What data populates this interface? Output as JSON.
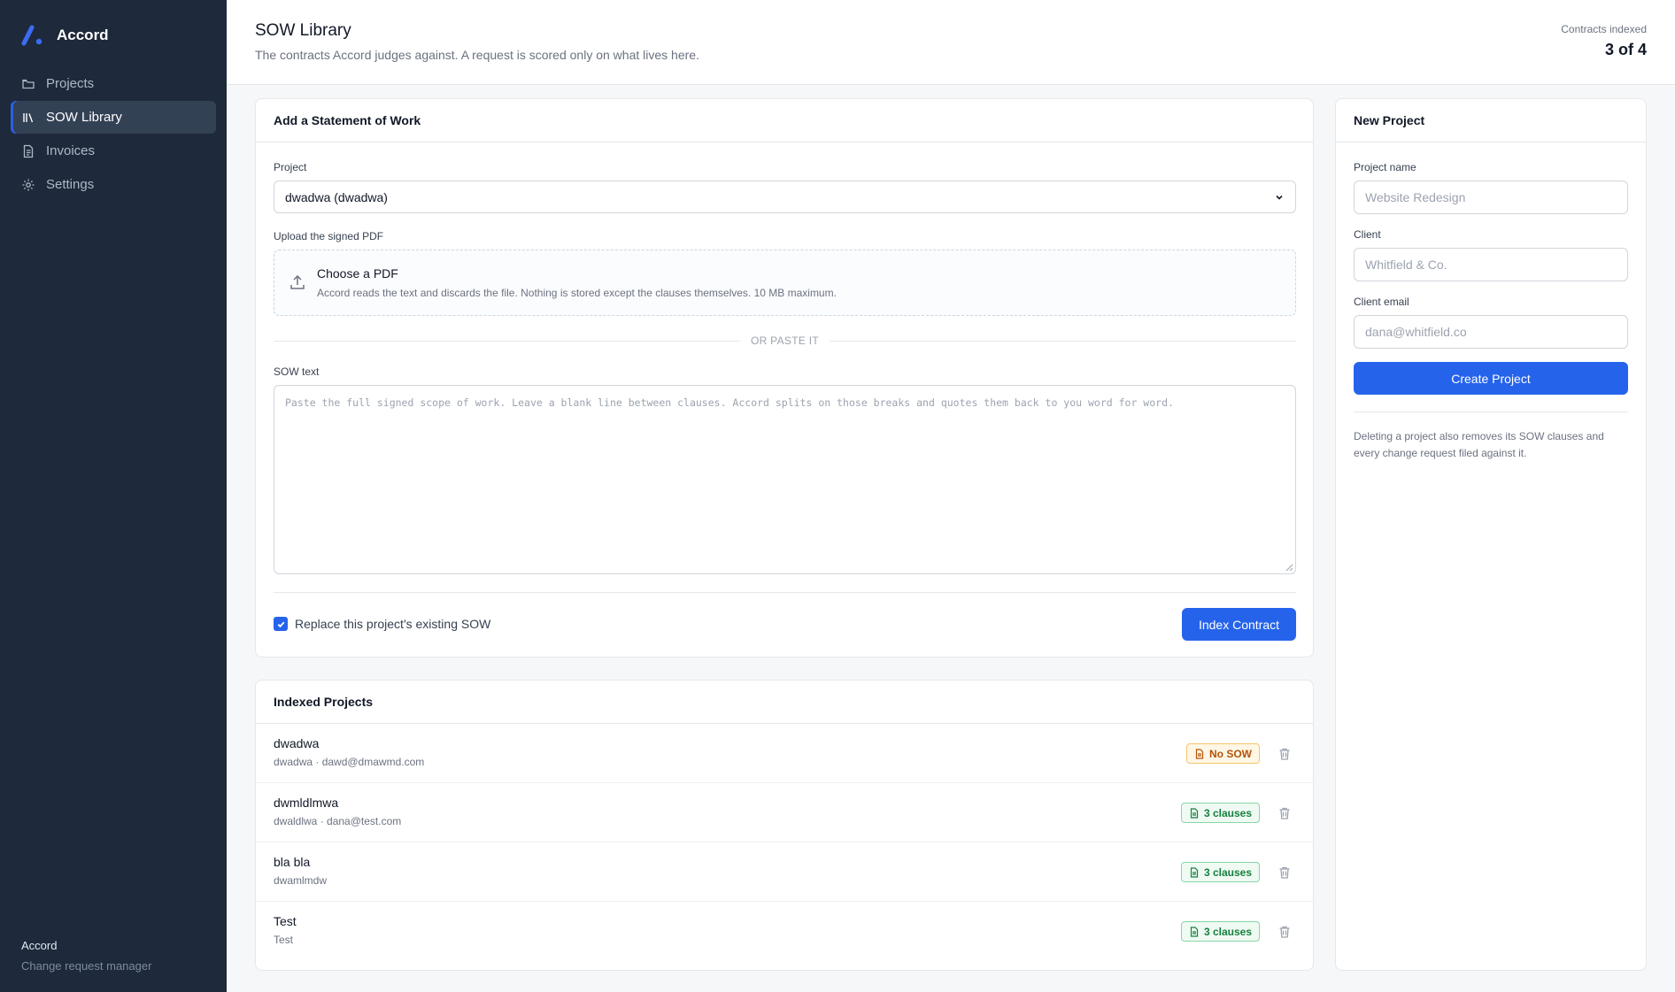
{
  "brand": {
    "name": "Accord",
    "accent": "#2563eb"
  },
  "sidebar": {
    "items": [
      {
        "label": "Projects",
        "icon": "folder-icon"
      },
      {
        "label": "SOW Library",
        "icon": "library-icon",
        "active": true
      },
      {
        "label": "Invoices",
        "icon": "invoice-icon"
      },
      {
        "label": "Settings",
        "icon": "gear-icon"
      }
    ],
    "footer_title": "Accord",
    "footer_sub": "Change request manager"
  },
  "header": {
    "title": "SOW Library",
    "subtitle": "The contracts Accord judges against. A request is scored only on what lives here.",
    "stat_label": "Contracts indexed",
    "stat_value": "3 of 4"
  },
  "sow_form": {
    "title": "Add a Statement of Work",
    "project_label": "Project",
    "project_value": "dwadwa (dwadwa)",
    "upload_label": "Upload the signed PDF",
    "upload_title": "Choose a PDF",
    "upload_hint": "Accord reads the text and discards the file. Nothing is stored except the clauses themselves. 10 MB maximum.",
    "or_text": "OR PASTE IT",
    "sow_text_label": "SOW text",
    "sow_text_placeholder": "Paste the full signed scope of work. Leave a blank line between clauses. Accord splits on those breaks and quotes them back to you word for word.",
    "replace_label": "Replace this project's existing SOW",
    "replace_checked": true,
    "submit_label": "Index Contract"
  },
  "indexed": {
    "title": "Indexed Projects",
    "rows": [
      {
        "name": "dwadwa",
        "meta": "dwadwa · dawd@dmawmd.com",
        "badge": "No SOW",
        "status": "warn"
      },
      {
        "name": "dwmldlmwa",
        "meta": "dwaldlwa · dana@test.com",
        "badge": "3 clauses",
        "status": "ok"
      },
      {
        "name": "bla bla",
        "meta": "dwamlmdw",
        "badge": "3 clauses",
        "status": "ok"
      },
      {
        "name": "Test",
        "meta": "Test",
        "badge": "3 clauses",
        "status": "ok"
      }
    ]
  },
  "new_project": {
    "title": "New Project",
    "name_label": "Project name",
    "name_placeholder": "Website Redesign",
    "client_label": "Client",
    "client_placeholder": "Whitfield & Co.",
    "email_label": "Client email",
    "email_placeholder": "dana@whitfield.co",
    "submit_label": "Create Project",
    "note": "Deleting a project also removes its SOW clauses and every change request filed against it."
  }
}
